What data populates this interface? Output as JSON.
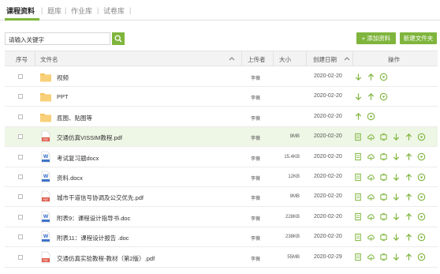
{
  "tabs": [
    {
      "label": "课程资料",
      "active": true
    },
    {
      "label": "题库",
      "active": false
    },
    {
      "label": "作业库",
      "active": false
    },
    {
      "label": "试卷库",
      "active": false
    }
  ],
  "search": {
    "value": "请输入关键字"
  },
  "toolbar": {
    "add_label": "+ 添加资料",
    "new_folder_label": "新建文件夹"
  },
  "table": {
    "headers": {
      "index": "序号",
      "name": "文件名",
      "uploader": "上传者",
      "size": "大小",
      "date": "创建日期",
      "actions": "操作"
    },
    "rows": [
      {
        "type": "folder",
        "name": "视频",
        "uploader": "李薇",
        "size": "",
        "date": "2020-02-20",
        "actions": [
          "download",
          "upload",
          "more"
        ],
        "highlight": false
      },
      {
        "type": "folder",
        "name": "PPT",
        "uploader": "李薇",
        "size": "",
        "date": "2020-02-20",
        "actions": [
          "download",
          "upload",
          "more"
        ],
        "highlight": false
      },
      {
        "type": "folder",
        "name": "底图、贴图等",
        "uploader": "李薇",
        "size": "",
        "date": "2020-02-20",
        "actions": [
          "upload",
          "more"
        ],
        "highlight": false
      },
      {
        "type": "pdf",
        "name": "交通仿真VISSIM教程.pdf",
        "uploader": "李薇",
        "size": "9MB",
        "date": "2020-02-20",
        "actions": [
          "doc",
          "cloud",
          "copy",
          "download",
          "upload",
          "more"
        ],
        "highlight": true
      },
      {
        "type": "word",
        "name": "考试复习题docx",
        "uploader": "李薇",
        "size": "15.4KB",
        "date": "2020-02-20",
        "actions": [
          "doc",
          "cloud",
          "copy",
          "download",
          "upload",
          "more"
        ],
        "highlight": false
      },
      {
        "type": "word",
        "name": "资料.docx",
        "uploader": "李薇",
        "size": "12KB",
        "date": "2020-02-20",
        "actions": [
          "doc",
          "cloud",
          "copy",
          "download",
          "upload",
          "more"
        ],
        "highlight": false
      },
      {
        "type": "pdf",
        "name": "城市干道信号协调及公交优先.pdf",
        "uploader": "李薇",
        "size": "9MB",
        "date": "2020-02-20",
        "actions": [
          "doc",
          "cloud",
          "copy",
          "download",
          "upload",
          "more"
        ],
        "highlight": false
      },
      {
        "type": "word",
        "name": "附表9：课程设计指导书.doc",
        "uploader": "李薇",
        "size": "228KB",
        "date": "2020-02-20",
        "actions": [
          "doc",
          "cloud",
          "copy",
          "download",
          "upload",
          "more"
        ],
        "highlight": false
      },
      {
        "type": "word",
        "name": "附表11：课程设计报告 .doc",
        "uploader": "李薇",
        "size": "238KB",
        "date": "2020-02-20",
        "actions": [
          "doc",
          "cloud",
          "copy",
          "download",
          "upload",
          "more"
        ],
        "highlight": false
      },
      {
        "type": "pdf",
        "name": "交通仿真实验教程-教材（第2版）.pdf",
        "uploader": "李薇",
        "size": "55MB",
        "date": "2020-02-29",
        "actions": [
          "doc",
          "cloud",
          "copy",
          "download",
          "upload",
          "more"
        ],
        "highlight": false
      }
    ]
  },
  "colors": {
    "accent": "#7fb53d",
    "folder": "#f6c45c",
    "pdf": "#e05a4a",
    "word": "#3f74c8"
  }
}
